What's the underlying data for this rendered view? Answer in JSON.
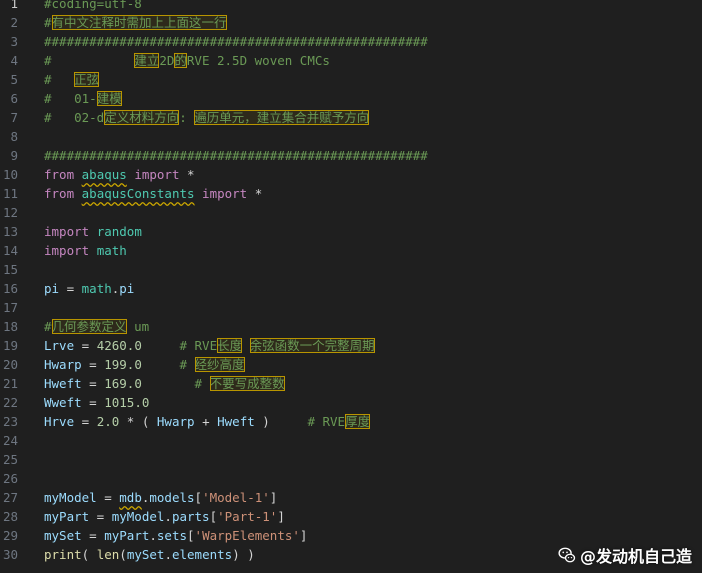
{
  "watermark": {
    "text": "@发动机自己造",
    "icon": "wechat-logo"
  },
  "editor": {
    "active_line": 1,
    "lines": [
      {
        "num": "1",
        "tokens": [
          {
            "t": "#coding=utf-8",
            "c": "comment"
          }
        ]
      },
      {
        "num": "2",
        "tokens": [
          {
            "t": "#",
            "c": "comment"
          },
          {
            "t": "有中文注释时需加上上面这一行",
            "c": "comment",
            "hl": true
          }
        ]
      },
      {
        "num": "3",
        "tokens": [
          {
            "t": "###################################################",
            "c": "comment"
          }
        ]
      },
      {
        "num": "4",
        "tokens": [
          {
            "t": "#           ",
            "c": "comment"
          },
          {
            "t": "建立",
            "c": "comment",
            "hl": true
          },
          {
            "t": "2D",
            "c": "comment"
          },
          {
            "t": "的",
            "c": "comment",
            "hl": true
          },
          {
            "t": "RVE 2.5D woven CMCs",
            "c": "comment"
          }
        ]
      },
      {
        "num": "5",
        "tokens": [
          {
            "t": "#   ",
            "c": "comment"
          },
          {
            "t": "正弦",
            "c": "comment",
            "hl": true
          }
        ]
      },
      {
        "num": "6",
        "tokens": [
          {
            "t": "#   01-",
            "c": "comment"
          },
          {
            "t": "建模",
            "c": "comment",
            "hl": true
          }
        ]
      },
      {
        "num": "7",
        "tokens": [
          {
            "t": "#   02-d",
            "c": "comment"
          },
          {
            "t": "定义材料方向",
            "c": "comment",
            "hl": true
          },
          {
            "t": ": ",
            "c": "comment"
          },
          {
            "t": "遍历单元，建立集合并赋予方向",
            "c": "comment",
            "hl": true
          }
        ]
      },
      {
        "num": "8",
        "tokens": []
      },
      {
        "num": "9",
        "tokens": [
          {
            "t": "###################################################",
            "c": "comment"
          }
        ]
      },
      {
        "num": "10",
        "tokens": [
          {
            "t": "from ",
            "c": "keyword"
          },
          {
            "t": "abaqus",
            "c": "module",
            "sq": true
          },
          {
            "t": " import ",
            "c": "keyword"
          },
          {
            "t": "*",
            "c": "punc"
          }
        ]
      },
      {
        "num": "11",
        "tokens": [
          {
            "t": "from ",
            "c": "keyword"
          },
          {
            "t": "abaqusConstants",
            "c": "module",
            "sq": true
          },
          {
            "t": " import ",
            "c": "keyword"
          },
          {
            "t": "*",
            "c": "punc"
          }
        ]
      },
      {
        "num": "12",
        "tokens": []
      },
      {
        "num": "13",
        "tokens": [
          {
            "t": "import ",
            "c": "keyword"
          },
          {
            "t": "random",
            "c": "module"
          }
        ]
      },
      {
        "num": "14",
        "tokens": [
          {
            "t": "import ",
            "c": "keyword"
          },
          {
            "t": "math",
            "c": "module"
          }
        ]
      },
      {
        "num": "15",
        "tokens": []
      },
      {
        "num": "16",
        "tokens": [
          {
            "t": "pi",
            "c": "ident"
          },
          {
            "t": " = ",
            "c": "punc"
          },
          {
            "t": "math",
            "c": "module"
          },
          {
            "t": ".",
            "c": "punc"
          },
          {
            "t": "pi",
            "c": "ident"
          }
        ]
      },
      {
        "num": "17",
        "tokens": []
      },
      {
        "num": "18",
        "tokens": [
          {
            "t": "#",
            "c": "comment"
          },
          {
            "t": "几何参数定义",
            "c": "comment",
            "hl": true
          },
          {
            "t": " um",
            "c": "comment"
          }
        ]
      },
      {
        "num": "19",
        "tokens": [
          {
            "t": "Lrve",
            "c": "ident"
          },
          {
            "t": " = ",
            "c": "punc"
          },
          {
            "t": "4260.0",
            "c": "number"
          },
          {
            "t": "     # RVE",
            "c": "comment"
          },
          {
            "t": "长度",
            "c": "comment",
            "hl": true
          },
          {
            "t": " ",
            "c": "comment"
          },
          {
            "t": "余弦函数一个完整周期",
            "c": "comment",
            "hl": true
          }
        ]
      },
      {
        "num": "20",
        "tokens": [
          {
            "t": "Hwarp",
            "c": "ident"
          },
          {
            "t": " = ",
            "c": "punc"
          },
          {
            "t": "199.0",
            "c": "number"
          },
          {
            "t": "     # ",
            "c": "comment"
          },
          {
            "t": "经纱高度",
            "c": "comment",
            "hl": true
          }
        ]
      },
      {
        "num": "21",
        "tokens": [
          {
            "t": "Hweft",
            "c": "ident"
          },
          {
            "t": " = ",
            "c": "punc"
          },
          {
            "t": "169.0",
            "c": "number"
          },
          {
            "t": "       # ",
            "c": "comment"
          },
          {
            "t": "不要写成整数",
            "c": "comment",
            "hl": true
          }
        ]
      },
      {
        "num": "22",
        "tokens": [
          {
            "t": "Wweft",
            "c": "ident"
          },
          {
            "t": " = ",
            "c": "punc"
          },
          {
            "t": "1015.0",
            "c": "number"
          }
        ]
      },
      {
        "num": "23",
        "tokens": [
          {
            "t": "Hrve",
            "c": "ident"
          },
          {
            "t": " = ",
            "c": "punc"
          },
          {
            "t": "2.0",
            "c": "number"
          },
          {
            "t": " * ( ",
            "c": "punc"
          },
          {
            "t": "Hwarp",
            "c": "ident"
          },
          {
            "t": " + ",
            "c": "punc"
          },
          {
            "t": "Hweft",
            "c": "ident"
          },
          {
            "t": " )",
            "c": "punc"
          },
          {
            "t": "     # RVE",
            "c": "comment"
          },
          {
            "t": "厚度",
            "c": "comment",
            "hl": true
          }
        ]
      },
      {
        "num": "24",
        "tokens": []
      },
      {
        "num": "25",
        "tokens": []
      },
      {
        "num": "26",
        "tokens": []
      },
      {
        "num": "27",
        "tokens": [
          {
            "t": "myModel",
            "c": "ident"
          },
          {
            "t": " = ",
            "c": "punc"
          },
          {
            "t": "mdb",
            "c": "ident",
            "sq": true
          },
          {
            "t": ".",
            "c": "punc"
          },
          {
            "t": "models",
            "c": "ident"
          },
          {
            "t": "[",
            "c": "punc"
          },
          {
            "t": "'Model-1'",
            "c": "string"
          },
          {
            "t": "]",
            "c": "punc"
          }
        ]
      },
      {
        "num": "28",
        "tokens": [
          {
            "t": "myPart",
            "c": "ident"
          },
          {
            "t": " = ",
            "c": "punc"
          },
          {
            "t": "myModel",
            "c": "ident"
          },
          {
            "t": ".",
            "c": "punc"
          },
          {
            "t": "parts",
            "c": "ident"
          },
          {
            "t": "[",
            "c": "punc"
          },
          {
            "t": "'Part-1'",
            "c": "string"
          },
          {
            "t": "]",
            "c": "punc"
          }
        ]
      },
      {
        "num": "29",
        "tokens": [
          {
            "t": "mySet",
            "c": "ident"
          },
          {
            "t": " = ",
            "c": "punc"
          },
          {
            "t": "myPart",
            "c": "ident"
          },
          {
            "t": ".",
            "c": "punc"
          },
          {
            "t": "sets",
            "c": "ident"
          },
          {
            "t": "[",
            "c": "punc"
          },
          {
            "t": "'WarpElements'",
            "c": "string"
          },
          {
            "t": "]",
            "c": "punc"
          }
        ]
      },
      {
        "num": "30",
        "tokens": [
          {
            "t": "print",
            "c": "func"
          },
          {
            "t": "( ",
            "c": "punc"
          },
          {
            "t": "len",
            "c": "func"
          },
          {
            "t": "(",
            "c": "punc"
          },
          {
            "t": "mySet",
            "c": "ident"
          },
          {
            "t": ".",
            "c": "punc"
          },
          {
            "t": "elements",
            "c": "ident"
          },
          {
            "t": ") )",
            "c": "punc"
          }
        ]
      }
    ]
  }
}
